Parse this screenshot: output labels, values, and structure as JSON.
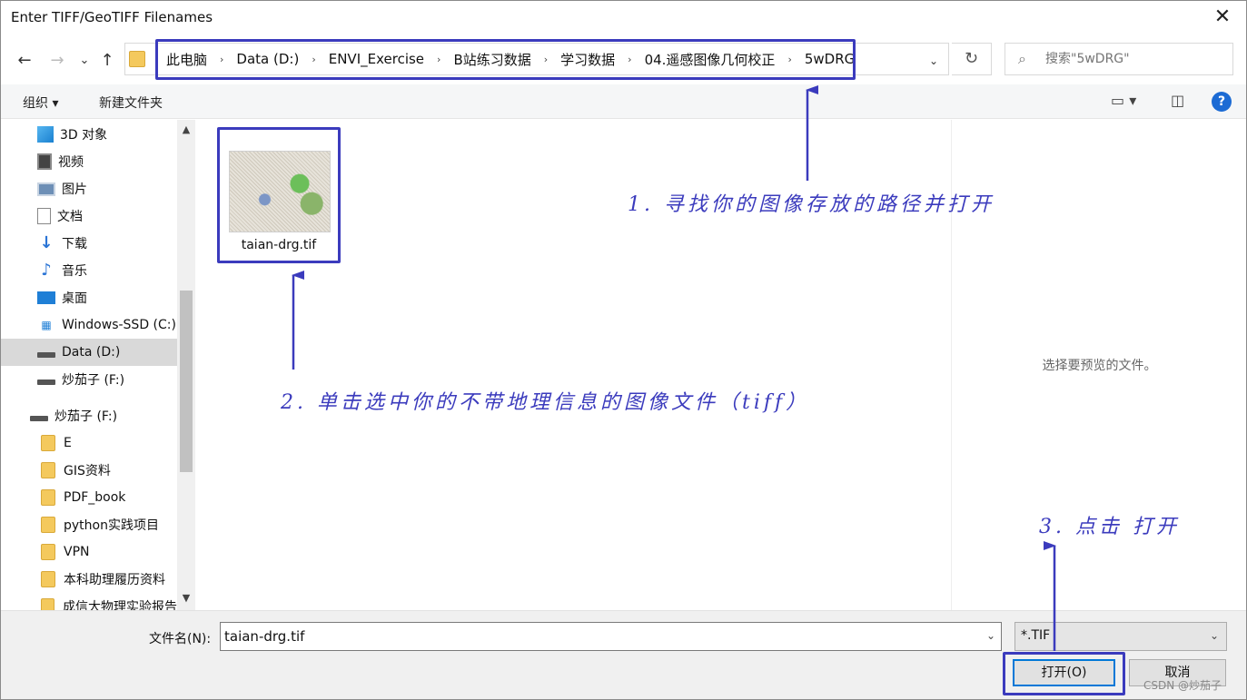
{
  "window": {
    "title": "Enter TIFF/GeoTIFF Filenames",
    "close_glyph": "✕"
  },
  "nav": {
    "back_glyph": "←",
    "forward_glyph": "→",
    "recent_glyph": "⌄",
    "up_glyph": "↑",
    "breadcrumbs": [
      "此电脑",
      "Data (D:)",
      "ENVI_Exercise",
      "B站练习数据",
      "学习数据",
      "04.遥感图像几何校正",
      "5wDRG"
    ],
    "separator": "›",
    "refresh_glyph": "↻",
    "search_placeholder": "搜索\"5wDRG\""
  },
  "toolbar": {
    "organize_label": "组织 ▾",
    "new_folder_label": "新建文件夹"
  },
  "sidebar": {
    "items": [
      {
        "label": "3D 对象",
        "icon": "cube-icon"
      },
      {
        "label": "视频",
        "icon": "video-icon"
      },
      {
        "label": "图片",
        "icon": "picture-icon"
      },
      {
        "label": "文档",
        "icon": "document-icon"
      },
      {
        "label": "下载",
        "icon": "download-icon"
      },
      {
        "label": "音乐",
        "icon": "music-icon"
      },
      {
        "label": "桌面",
        "icon": "desktop-icon"
      },
      {
        "label": "Windows-SSD (C:)",
        "icon": "windows-drive-icon"
      },
      {
        "label": "Data (D:)",
        "icon": "drive-icon",
        "selected": true
      },
      {
        "label": "炒茄子 (F:)",
        "icon": "drive-icon"
      },
      {
        "label": "炒茄子 (F:)",
        "icon": "drive-icon"
      },
      {
        "label": "E",
        "icon": "folder-icon"
      },
      {
        "label": "GIS资料",
        "icon": "folder-icon"
      },
      {
        "label": "PDF_book",
        "icon": "folder-icon"
      },
      {
        "label": "python实践项目",
        "icon": "folder-icon"
      },
      {
        "label": "VPN",
        "icon": "folder-icon"
      },
      {
        "label": "本科助理履历资料",
        "icon": "folder-icon"
      },
      {
        "label": "成信大物理实验报告",
        "icon": "folder-icon"
      }
    ]
  },
  "files": [
    {
      "name": "taian-drg.tif"
    }
  ],
  "preview": {
    "message": "选择要预览的文件。"
  },
  "bottom": {
    "filename_label": "文件名(N):",
    "filename_value": "taian-drg.tif",
    "filetype_value": "*.TIF",
    "open_label": "打开(O)",
    "cancel_label": "取消"
  },
  "annotations": {
    "step1": "1. 寻找你的图像存放的路径并打开",
    "step2": "2. 单击选中你的不带地理信息的图像文件（tiff）",
    "step3": "3. 点击 打开"
  },
  "watermark": "CSDN @炒茄子",
  "colors": {
    "annotation": "#3b3bbd",
    "accent": "#0078d7"
  }
}
